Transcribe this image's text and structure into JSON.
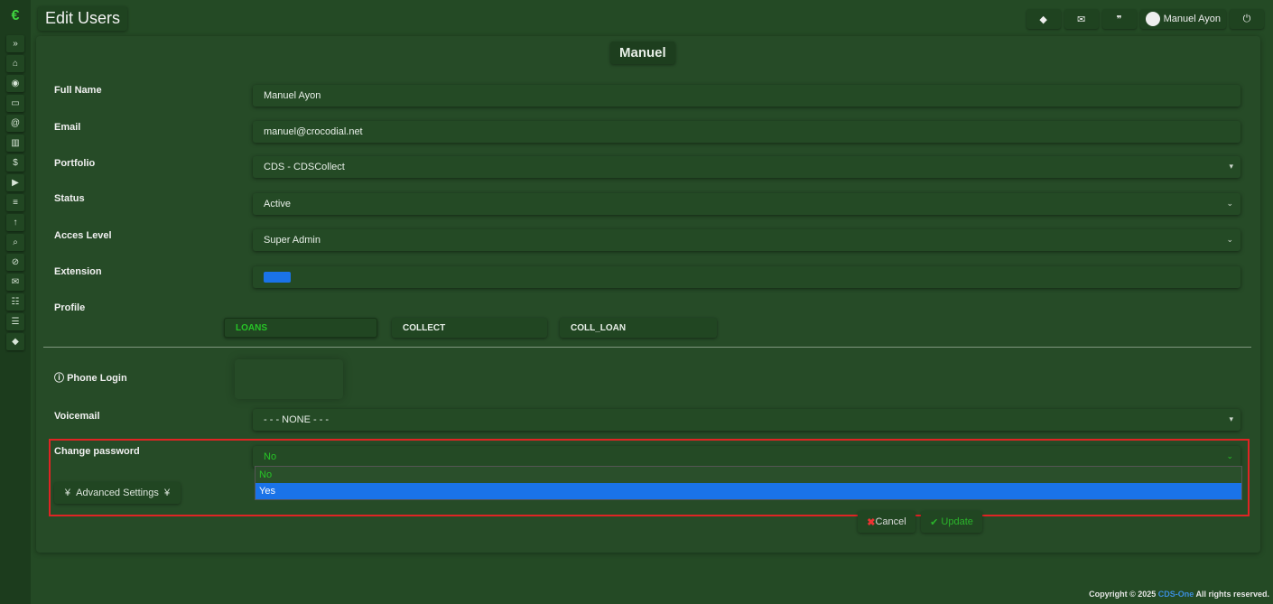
{
  "app": {
    "logo": "€",
    "title": "Edit Users"
  },
  "topbar": {
    "icons": [
      "tag-icon",
      "envelope-icon",
      "chat-icon"
    ],
    "user_name": "Manuel Ayon",
    "power_icon": "power-icon"
  },
  "sidebar": {
    "items": [
      {
        "icon": "»",
        "name": "expand-icon"
      },
      {
        "icon": "⌂",
        "name": "home-icon"
      },
      {
        "icon": "◉",
        "name": "dashboard-icon"
      },
      {
        "icon": "▭",
        "name": "monitor-icon"
      },
      {
        "icon": "@",
        "name": "at-icon"
      },
      {
        "icon": "▥",
        "name": "chart-icon"
      },
      {
        "icon": "$",
        "name": "dollar-icon"
      },
      {
        "icon": "▶",
        "name": "play-icon"
      },
      {
        "icon": "≡",
        "name": "list-icon"
      },
      {
        "icon": "↑",
        "name": "upload-icon"
      },
      {
        "icon": "⌕",
        "name": "search-icon"
      },
      {
        "icon": "⊘",
        "name": "ban-icon"
      },
      {
        "icon": "✉",
        "name": "mail-icon"
      },
      {
        "icon": "☷",
        "name": "users-icon"
      },
      {
        "icon": "☰",
        "name": "sliders-icon"
      },
      {
        "icon": "◆",
        "name": "tag-icon"
      }
    ]
  },
  "form": {
    "user_tag": "Manuel",
    "full_name": {
      "label": "Full Name",
      "value": "Manuel Ayon"
    },
    "email": {
      "label": "Email",
      "value": "manuel@crocodial.net"
    },
    "portfolio": {
      "label": "Portfolio",
      "value": "CDS - CDSCollect"
    },
    "status": {
      "label": "Status",
      "value": "Active"
    },
    "access_level": {
      "label": "Acces Level",
      "value": "Super Admin"
    },
    "extension": {
      "label": "Extension"
    },
    "profile": {
      "label": "Profile",
      "options": [
        "LOANS",
        "COLLECT",
        "COLL_LOAN"
      ],
      "selected": "LOANS"
    },
    "phone_login": {
      "label": "Phone Login"
    },
    "voicemail": {
      "label": "Voicemail",
      "value": "- - - NONE - - -"
    },
    "change_password": {
      "label": "Change password",
      "value": "No",
      "options": [
        "No",
        "Yes"
      ],
      "highlighted": "Yes"
    },
    "advanced_settings": "Advanced Settings",
    "cancel": "Cancel",
    "update": "Update"
  },
  "footer": {
    "prefix": "Copyright © 2025 ",
    "brand": "CDS-One",
    "suffix": " All rights reserved."
  },
  "colors": {
    "accent_green": "#3fd13f",
    "highlight_blue": "#1a73e8",
    "alert_red": "#e02424"
  }
}
